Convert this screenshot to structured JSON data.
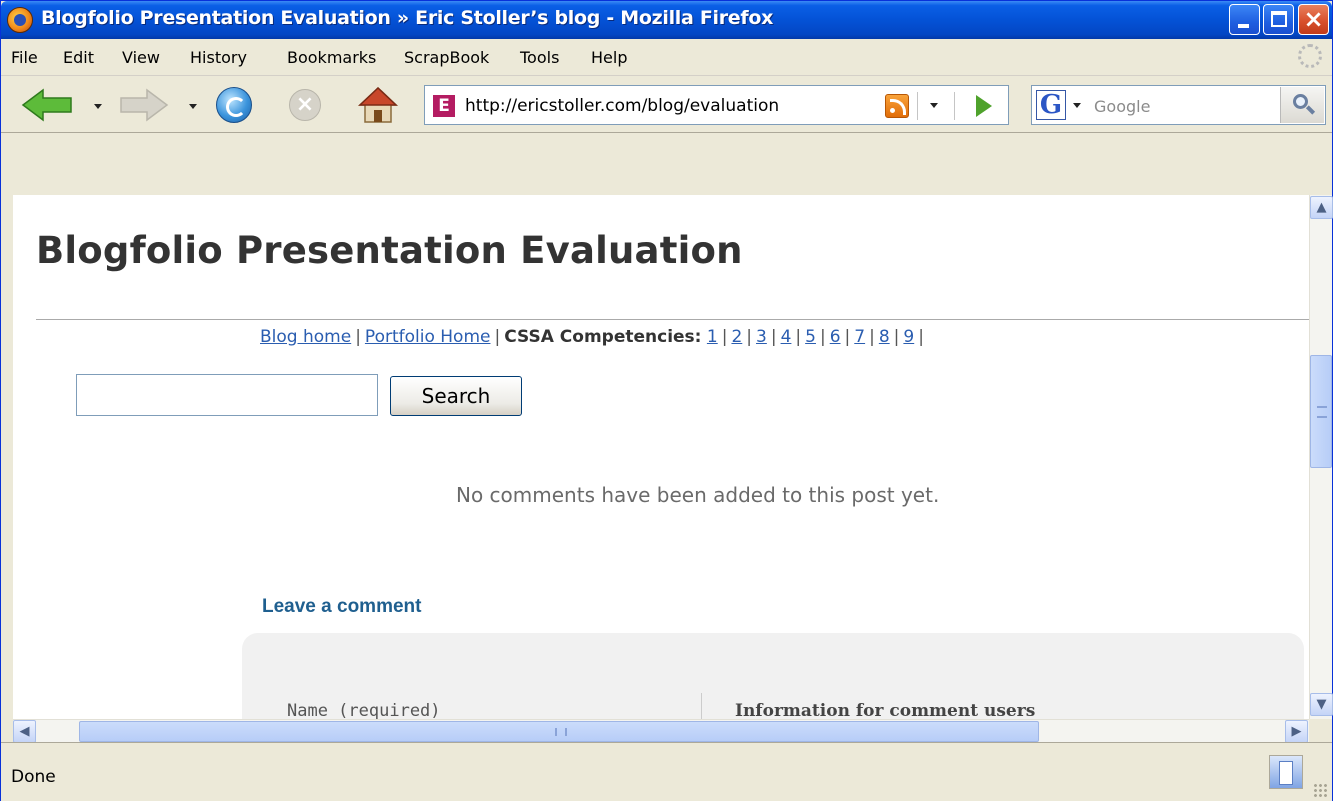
{
  "window": {
    "title": "Blogfolio Presentation Evaluation » Eric Stoller’s blog - Mozilla Firefox"
  },
  "menu": {
    "items": [
      {
        "label": "File"
      },
      {
        "label": "Edit"
      },
      {
        "label": "View"
      },
      {
        "label": "History"
      },
      {
        "label": "Bookmarks"
      },
      {
        "label": "ScrapBook"
      },
      {
        "label": "Tools"
      },
      {
        "label": "Help"
      }
    ]
  },
  "toolbar": {
    "url": "http://ericstoller.com/blog/evaluation",
    "site_icon_letter": "E",
    "search_engine_letter": "G",
    "search_placeholder": "Google"
  },
  "page": {
    "title": "Blogfolio Presentation Evaluation",
    "nav": {
      "blog_home": "Blog home",
      "portfolio_home": "Portfolio Home",
      "competencies_label": "CSSA Competencies:",
      "competencies": [
        "1",
        "2",
        "3",
        "4",
        "5",
        "6",
        "7",
        "8",
        "9"
      ]
    },
    "search_button": "Search",
    "no_comments": "No comments have been added to this post yet.",
    "leave_comment": "Leave a comment",
    "name_label": "Name (required)",
    "info_label": "Information for comment users"
  },
  "status": {
    "text": "Done"
  },
  "colors": {
    "titlebar": "#0452d6",
    "link": "#2a5db0",
    "heading_accent": "#1f5f8f"
  }
}
